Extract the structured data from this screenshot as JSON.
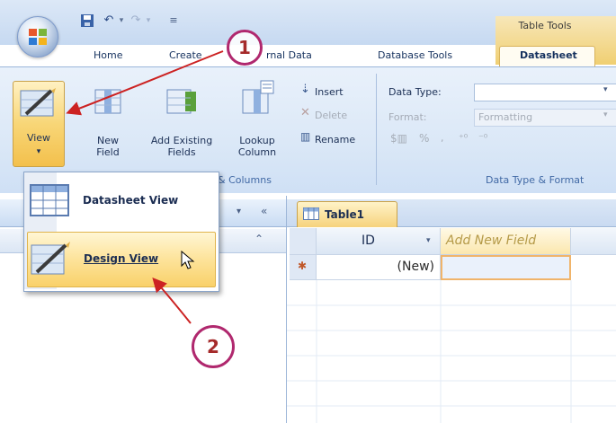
{
  "tabs": [
    "Home",
    "Create",
    "External Data",
    "Database Tools",
    "Datasheet"
  ],
  "tab_partial_label": "rnal Data",
  "context_tab_group": "Table Tools",
  "ribbon": {
    "view_label": "View",
    "new_field": [
      "New",
      "Field"
    ],
    "add_existing_fields": [
      "Add Existing",
      "Fields"
    ],
    "lookup_column": [
      "Lookup",
      "Column"
    ],
    "insert": "Insert",
    "delete": "Delete",
    "rename": "Rename",
    "fields_columns_group": "& Columns",
    "data_type_label": "Data Type:",
    "format_label": "Format:",
    "format_value": "Formatting",
    "data_type_group": "Data Type & Format"
  },
  "view_menu": {
    "datasheet_view": "Datasheet View",
    "design_view": "Design View"
  },
  "document": {
    "table_tab": "Table1",
    "columns": [
      "ID",
      "Add New Field"
    ],
    "new_row_value": "(New)",
    "new_row_marker": "✱"
  },
  "annotations": [
    "1",
    "2"
  ],
  "colors": {
    "annotation_circle": "#b0286e",
    "annotation_arrow": "#cc2222",
    "ribbon_bg": "#dbe8f7",
    "selected_highlight": "#f9d16a"
  }
}
